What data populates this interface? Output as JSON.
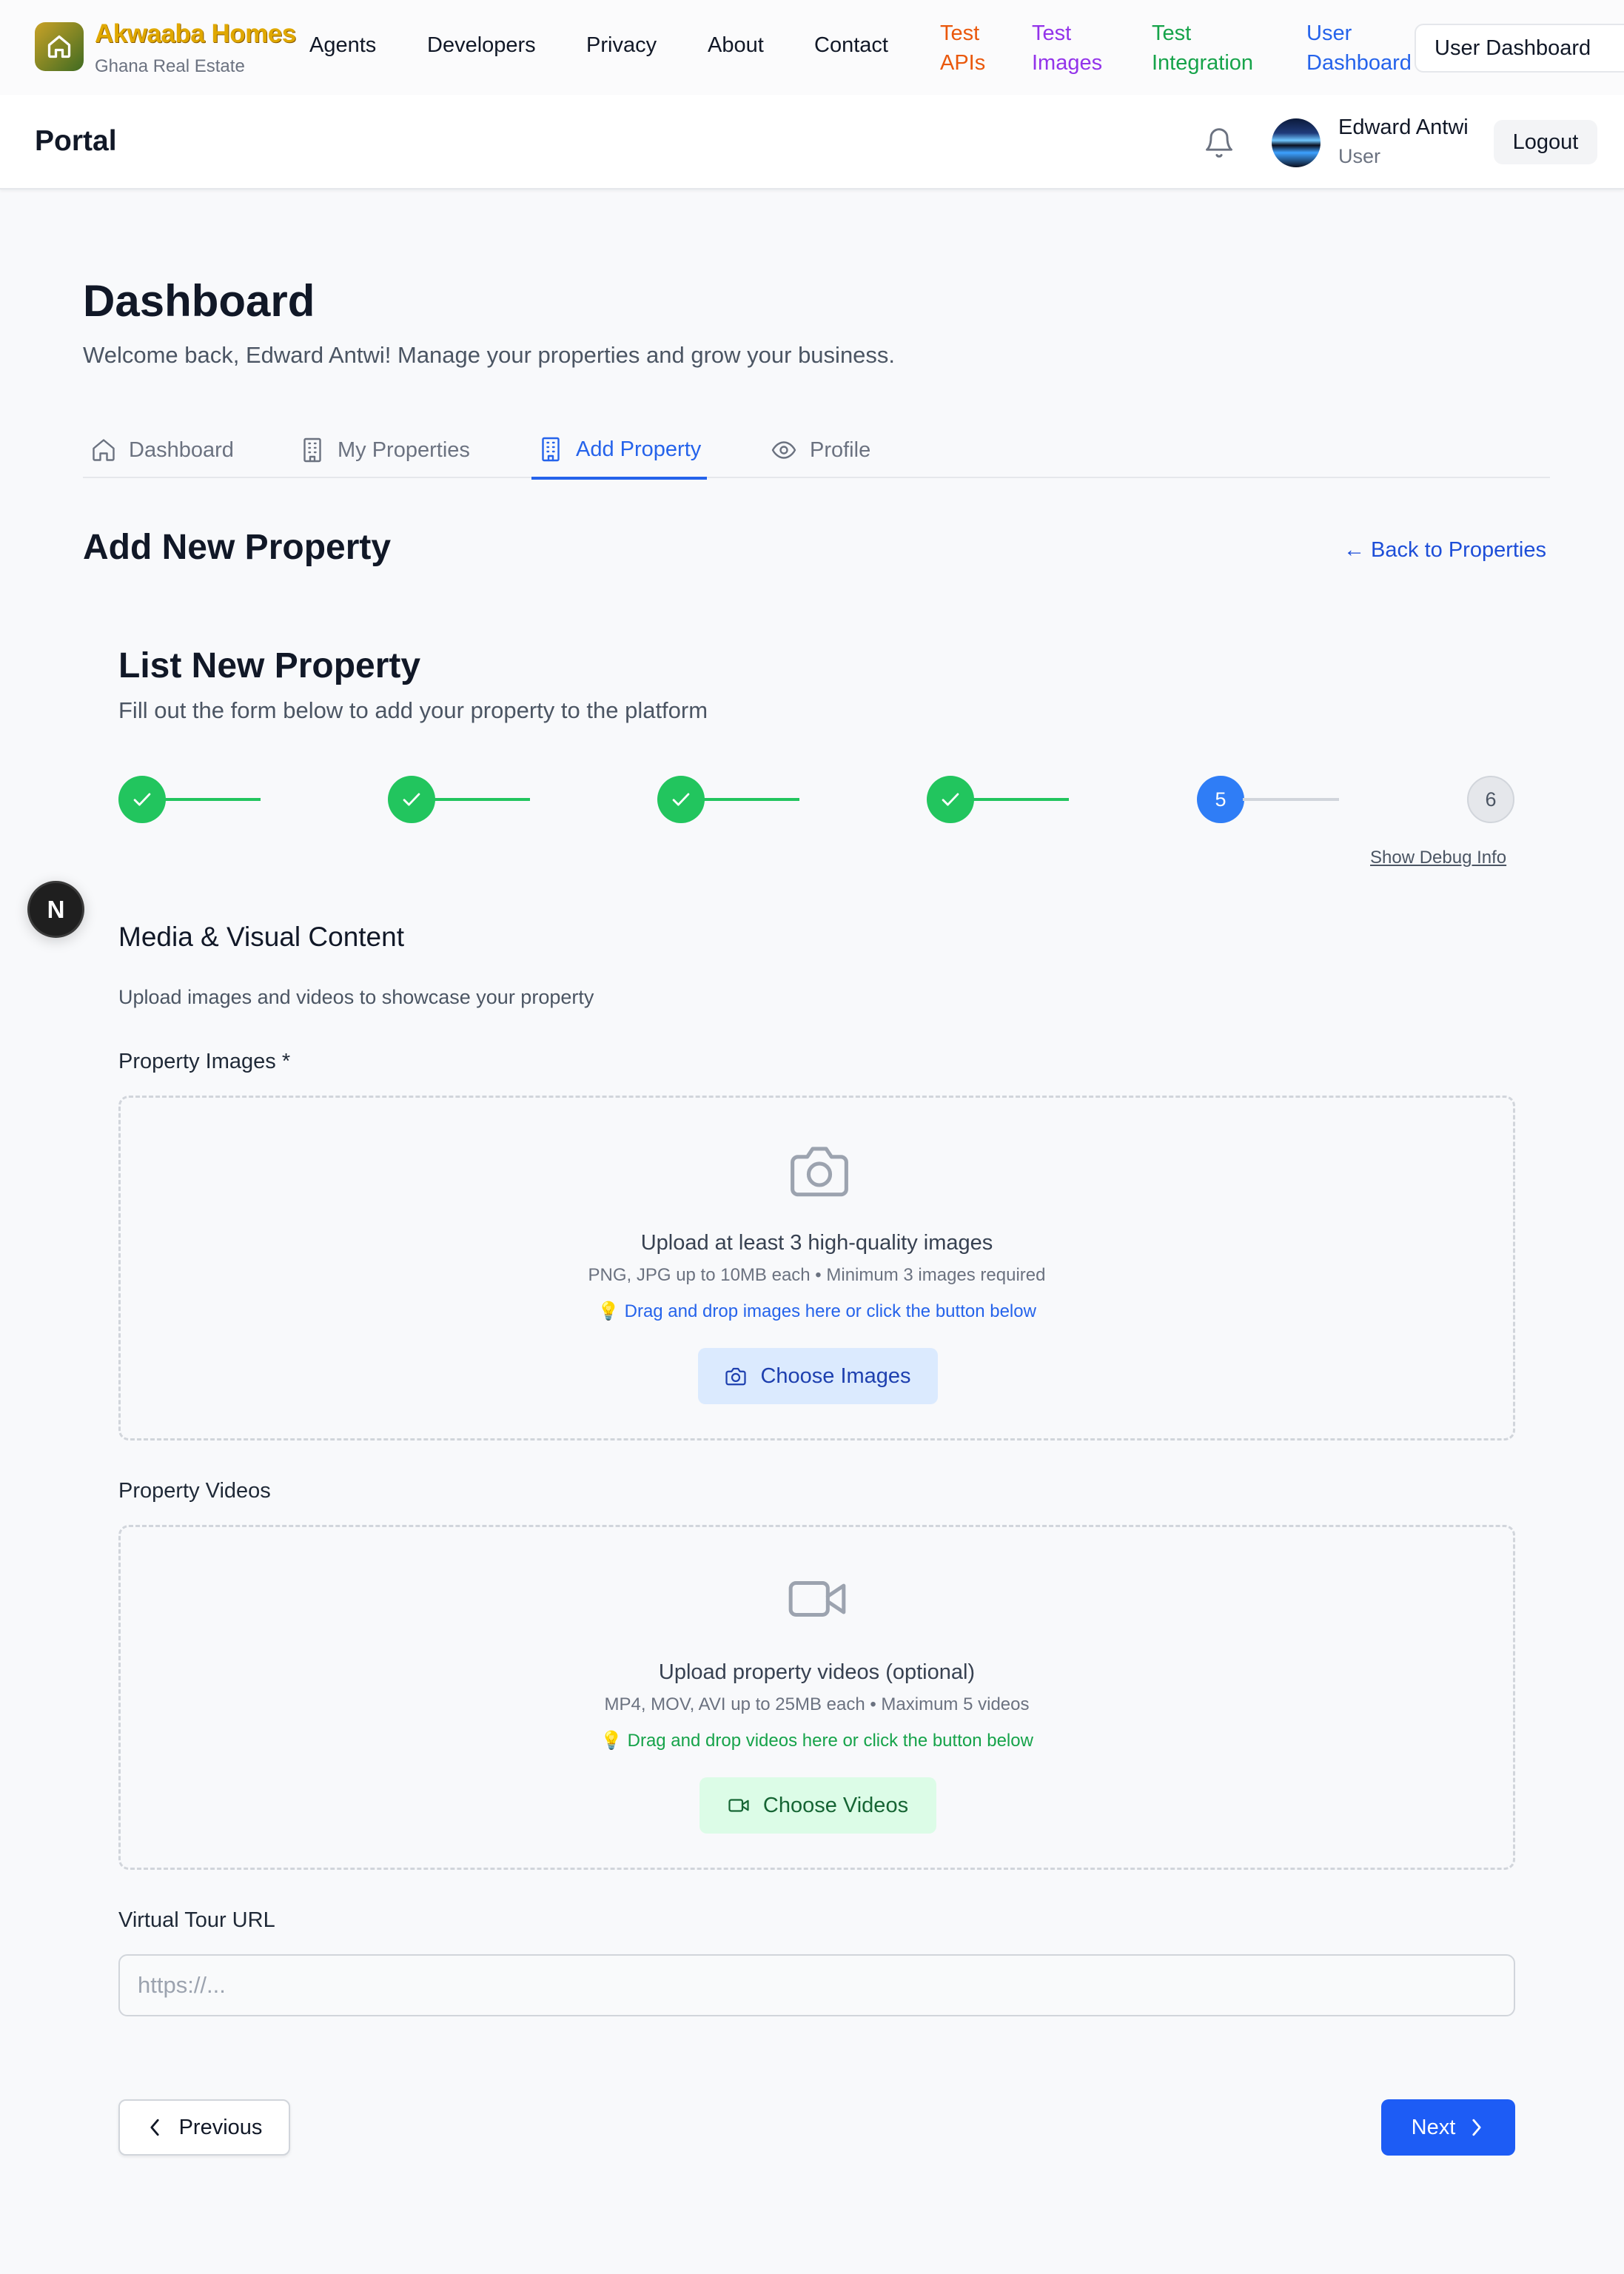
{
  "nav": {
    "brand_title": "Akwaaba Homes",
    "brand_subtitle": "Ghana Real Estate",
    "links": [
      "Agents",
      "Developers",
      "Privacy",
      "About",
      "Contact"
    ],
    "colored_links": [
      {
        "label": "Test APIs",
        "color": "#ea580c"
      },
      {
        "label": "Test Images",
        "color": "#9333ea"
      },
      {
        "label": "Test Integration",
        "color": "#16a34a"
      },
      {
        "label": "User Dashboard",
        "color": "#2563eb"
      }
    ],
    "user_dashboard_button": "User Dashboard"
  },
  "portal": {
    "title": "Portal",
    "user_name": "Edward Antwi",
    "user_role": "User",
    "logout_label": "Logout"
  },
  "page": {
    "title": "Dashboard",
    "subtitle": "Welcome back, Edward Antwi! Manage your properties and grow your business."
  },
  "tabs": [
    {
      "label": "Dashboard",
      "icon": "home-icon",
      "active": false
    },
    {
      "label": "My Properties",
      "icon": "building-icon",
      "active": false
    },
    {
      "label": "Add Property",
      "icon": "building-icon",
      "active": true
    },
    {
      "label": "Profile",
      "icon": "eye-icon",
      "active": false
    }
  ],
  "section": {
    "title": "Add New Property",
    "back_link": "← Back to Properties"
  },
  "form": {
    "title": "List New Property",
    "subtitle": "Fill out the form below to add your property to the platform",
    "steps": [
      {
        "status": "complete",
        "label": ""
      },
      {
        "status": "complete",
        "label": ""
      },
      {
        "status": "complete",
        "label": ""
      },
      {
        "status": "complete",
        "label": ""
      },
      {
        "status": "current",
        "label": "5"
      },
      {
        "status": "upcoming",
        "label": "6"
      }
    ],
    "debug_link": "Show Debug Info"
  },
  "dev_badge": "N",
  "media": {
    "title": "Media & Visual Content",
    "subtitle": "Upload images and videos to showcase your property",
    "images": {
      "label": "Property Images *",
      "main": "Upload at least 3 high-quality images",
      "hint": "PNG, JPG up to 10MB each • Minimum 3 images required",
      "tip": "💡 Drag and drop images here or click the button below",
      "button": "Choose Images"
    },
    "videos": {
      "label": "Property Videos",
      "main": "Upload property videos (optional)",
      "hint": "MP4, MOV, AVI up to 25MB each • Maximum 5 videos",
      "tip": "💡 Drag and drop videos here or click the button below",
      "button": "Choose Videos"
    },
    "virtual_tour": {
      "label": "Virtual Tour URL",
      "placeholder": "https://...",
      "value": ""
    }
  },
  "buttons": {
    "previous": "Previous",
    "next": "Next"
  },
  "colors": {
    "primary_blue": "#1d5cf5",
    "success_green": "#22c55e",
    "link_blue": "#2563eb"
  }
}
